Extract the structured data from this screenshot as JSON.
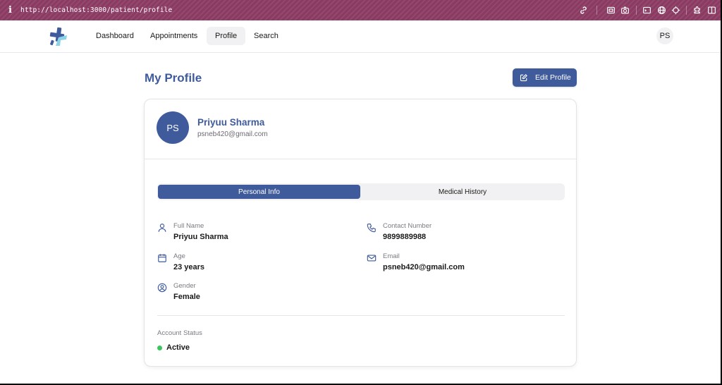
{
  "browser": {
    "info_glyph": "i",
    "url": "http://localhost:3000/patient/profile",
    "toolbar_icons": [
      "link-icon",
      "screenshot-icon",
      "camera-icon",
      "terminal-icon",
      "globe-icon",
      "crosshair-icon",
      "extension-icon",
      "sidebar-icon"
    ]
  },
  "nav": {
    "items": [
      {
        "label": "Dashboard"
      },
      {
        "label": "Appointments"
      },
      {
        "label": "Profile"
      },
      {
        "label": "Search"
      }
    ],
    "active": "Profile",
    "avatar_initials": "PS"
  },
  "page": {
    "title": "My Profile",
    "edit_button": "Edit Profile"
  },
  "user": {
    "initials": "PS",
    "name": "Priyuu Sharma",
    "email": "psneb420@gmail.com"
  },
  "tabs": [
    {
      "label": "Personal Info"
    },
    {
      "label": "Medical History"
    }
  ],
  "active_tab": "Personal Info",
  "fields": {
    "full_name": {
      "label": "Full Name",
      "value": "Priyuu Sharma",
      "icon": "user-icon"
    },
    "age": {
      "label": "Age",
      "value": "23 years",
      "icon": "calendar-icon"
    },
    "gender": {
      "label": "Gender",
      "value": "Female",
      "icon": "user-circle-icon"
    },
    "contact": {
      "label": "Contact Number",
      "value": "9899889988",
      "icon": "phone-icon"
    },
    "email": {
      "label": "Email",
      "value": "psneb420@gmail.com",
      "icon": "mail-icon"
    }
  },
  "account": {
    "label": "Account Status",
    "value": "Active",
    "status_color": "#3cc55a"
  },
  "colors": {
    "primary": "#3f5b9c",
    "browser_bar": "#8b3a62"
  }
}
